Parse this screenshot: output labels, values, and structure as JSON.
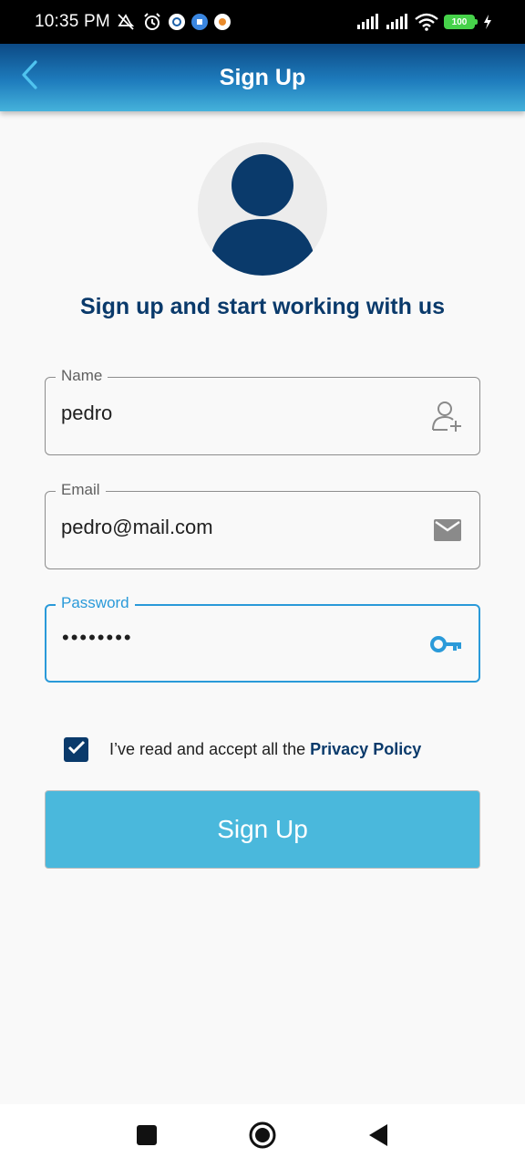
{
  "status_bar": {
    "time": "10:35 PM",
    "battery": "100",
    "icons": [
      "mute-icon",
      "alarm-icon",
      "app-icon-1",
      "app-icon-2",
      "app-icon-3",
      "signal-icon",
      "signal-icon",
      "wifi-icon",
      "battery-icon",
      "charging-icon"
    ]
  },
  "app_bar": {
    "title": "Sign Up",
    "back_icon": "chevron-left-icon"
  },
  "headline": "Sign up and start working with us",
  "form": {
    "name": {
      "label": "Name",
      "value": "pedro",
      "icon": "add-user-icon"
    },
    "email": {
      "label": "Email",
      "value": "pedro@mail.com",
      "icon": "mail-icon"
    },
    "password": {
      "label": "Password",
      "value": "••••••••",
      "icon": "key-icon"
    }
  },
  "privacy": {
    "checked": true,
    "text": "I’ve read and accept all the ",
    "link": "Privacy Policy"
  },
  "signup_button": "Sign Up",
  "colors": {
    "primary_dark": "#0a3a6b",
    "accent": "#2a9ad9",
    "button": "#4ab8dc"
  }
}
